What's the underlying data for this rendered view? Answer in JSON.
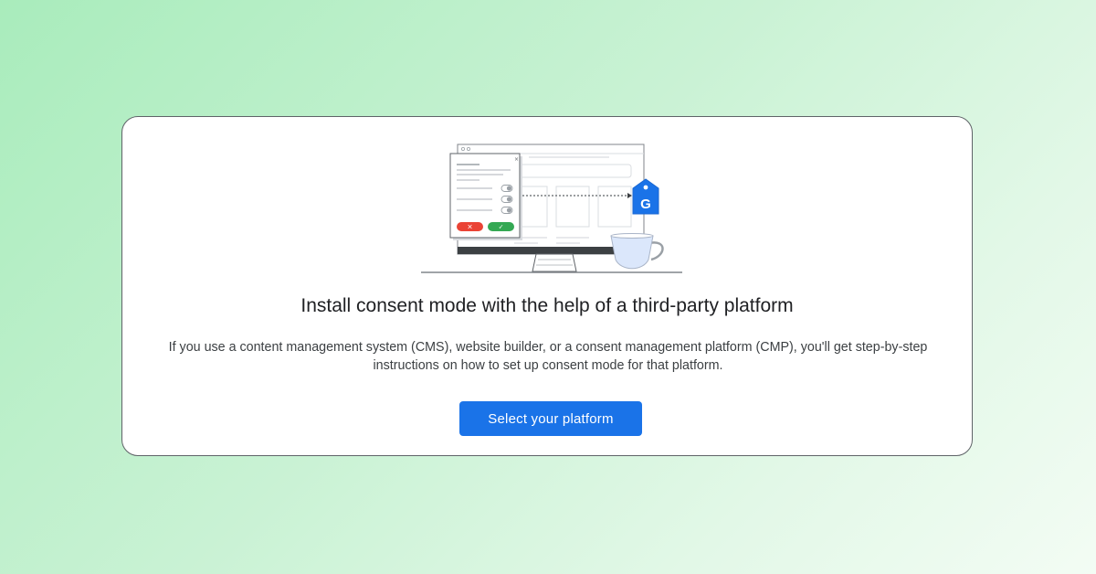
{
  "dialog": {
    "title": "Install consent mode with the help of a third-party platform",
    "description": "If you use a content management system (CMS), website builder, or a consent management platform (CMP), you'll get step-by-step instructions on how to set up consent mode for that platform.",
    "primary_button_label": "Select your platform"
  },
  "illustration": {
    "tag_letter": "G",
    "reject_icon": "close-icon",
    "accept_icon": "check-icon",
    "colors": {
      "tag_blue": "#1a73e8",
      "reject_red": "#ea4335",
      "accept_green": "#34a853",
      "cup_fill": "#dbe7fb"
    }
  },
  "colors": {
    "accent": "#1a73e8",
    "card_background": "#ffffff",
    "text_primary": "#202124"
  }
}
